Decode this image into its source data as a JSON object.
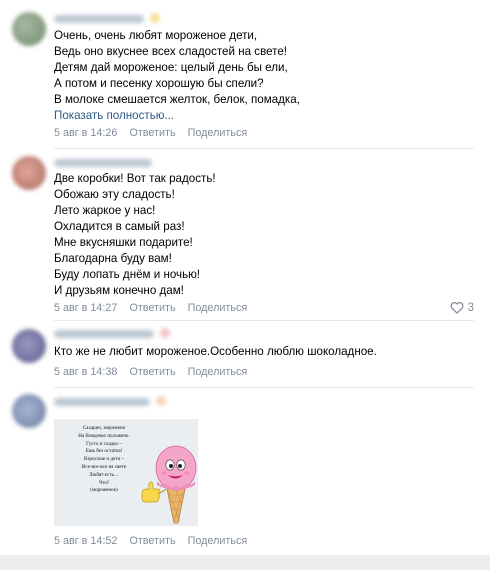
{
  "comments": [
    {
      "lines": [
        "Очень, очень любят мороженое дети,",
        "Ведь оно вкуснее всех сладостей на свете!",
        "Детям дай мороженое: целый день бы ели,",
        "А потом и песенку хорошую бы спели?",
        "В молоке смешается желток, белок, помадка,"
      ],
      "show_more": "Показать полностью...",
      "time": "5 авг в 14:26",
      "reply": "Ответить",
      "share": "Поделиться",
      "avatar_color": "#8a9f86"
    },
    {
      "lines": [
        "Две коробки! Вот так радость!",
        "Обожаю эту сладость!",
        "Лето жаркое у нас!",
        "Охладится в самый раз!",
        "Мне вкусняшки подарите!",
        "Благодарна буду вам!",
        "Буду лопать днём и ночью!",
        "И друзьям конечно дам!"
      ],
      "time": "5 авг в 14:27",
      "reply": "Ответить",
      "share": "Поделиться",
      "likes": "3",
      "like_icon": "heart-icon",
      "avatar_color": "#c98a7e"
    },
    {
      "lines": [
        "Кто же не любит мороженое.Особенно люблю шоколадное."
      ],
      "time": "5 авг в 14:38",
      "reply": "Ответить",
      "share": "Поделиться",
      "avatar_color": "#7d7aa6"
    },
    {
      "attachment": {
        "poem": [
          "Сахарно, морожено",
          "На блюдечко положено.",
          "Густо и сладко –",
          "Ешь без остатка!",
          "Взрослые и дети –",
          "Все-все-все на свете",
          "Любят есть…",
          "Что?",
          "(мороженое)"
        ]
      },
      "time": "5 авг в 14:52",
      "reply": "Ответить",
      "share": "Поделиться",
      "avatar_color": "#7f8fb0"
    }
  ],
  "colors": {
    "link": "#2a5885",
    "meta": "#818c99",
    "background": "#edeef0",
    "divider": "#e7e8ec"
  }
}
